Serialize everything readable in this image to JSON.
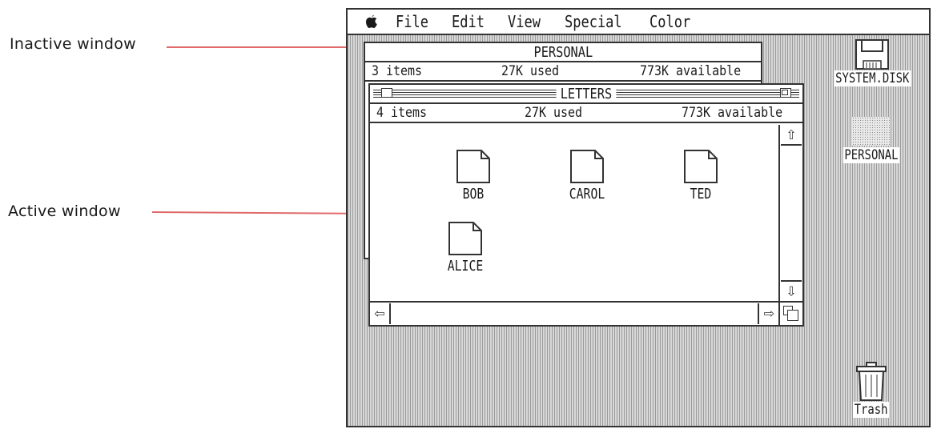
{
  "annotations": {
    "inactive_label": "Inactive window",
    "active_label": "Active window"
  },
  "menubar": {
    "items": [
      "File",
      "Edit",
      "View",
      "Special",
      "Color"
    ]
  },
  "inactive_window": {
    "title": "PERSONAL",
    "items": "3 items",
    "used": "27K used",
    "available": "773K available"
  },
  "active_window": {
    "title": "LETTERS",
    "items": "4 items",
    "used": "27K used",
    "available": "773K available",
    "files": [
      "BOB",
      "CAROL",
      "TED",
      "ALICE"
    ]
  },
  "desktop": {
    "disk_label": "SYSTEM.DISK",
    "folder_label": "PERSONAL",
    "trash_label": "Trash"
  },
  "colors": {
    "callout_line": "#e06a6a"
  }
}
